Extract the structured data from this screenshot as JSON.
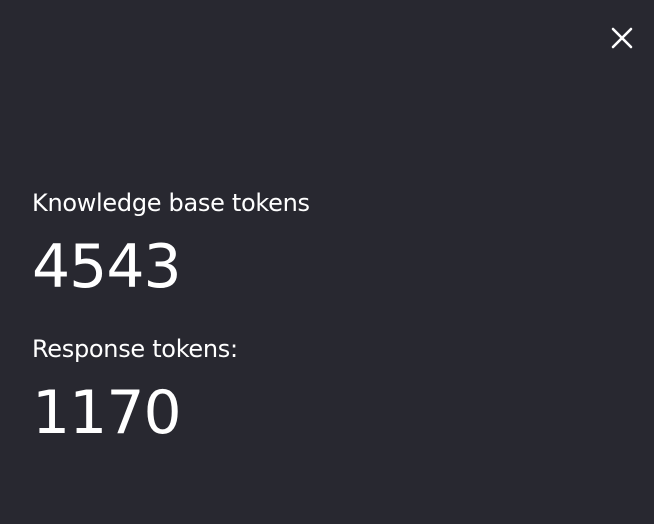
{
  "panel": {
    "close_icon": "close-icon"
  },
  "stats": [
    {
      "label": "Knowledge base tokens",
      "value": "4543"
    },
    {
      "label": "Response tokens:",
      "value": "1170"
    }
  ],
  "colors": {
    "background": "#282830",
    "text": "#ffffff"
  }
}
